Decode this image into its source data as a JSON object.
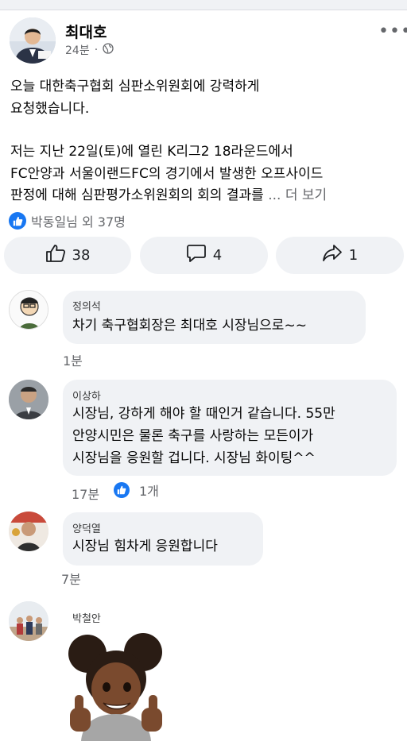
{
  "post": {
    "author": "최대호",
    "time": "24분",
    "separator": "·",
    "body_lines_1": [
      "오늘 대한축구협회 심판소위원회에 강력하게",
      "요청했습니다."
    ],
    "body_lines_2": [
      "저는 지난 22일(토)에 열린 K리그2 18라운드에서",
      "FC안양과  서울이랜드FC의 경기에서 발생한 오프사이드",
      "판정에 대해 심판평가소위원회의 회의 결과를 "
    ],
    "ellipsis": "...",
    "see_more": "더 보기",
    "reactions_text": "박동일님 외 37명",
    "like_count": "38",
    "comment_count": "4",
    "share_count": "1"
  },
  "comments": [
    {
      "name": "정의석",
      "lines": [
        "차기 축구협회장은 최대호 시장님으로~~"
      ],
      "time": "1분"
    },
    {
      "name": "이상하",
      "lines": [
        "시장님, 강하게 해야 할 때인거 같습니다. 55만",
        "안양시민은 물론 축구를 사랑하는 모든이가",
        "시장님을 응원할 겁니다. 시장님 화이팅^^"
      ],
      "time": "17분",
      "reaction_count": "1개"
    },
    {
      "name": "양덕열",
      "lines": [
        "시장님 힘차게 응원합니다"
      ],
      "time": "7분"
    },
    {
      "name": "박철안"
    }
  ],
  "icons": [
    "globe-icon",
    "more-options-icon",
    "like-reaction-icon",
    "thumbs-up-icon",
    "comment-icon",
    "share-icon",
    "sticker-avatar-thumbs-up"
  ],
  "colors": {
    "accent": "#1877f2",
    "bubble_bg": "#f0f2f5",
    "meta_text": "#65676b"
  }
}
